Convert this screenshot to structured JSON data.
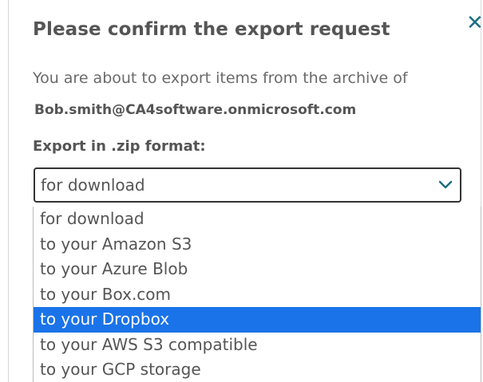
{
  "dialog": {
    "title": "Please confirm the export request",
    "close_glyph": "✕",
    "message": "You are about to export items from the archive of",
    "email": "Bob.smith@CA4software.onmicrosoft.com",
    "format_label": "Export in .zip format:"
  },
  "select": {
    "value": "for download",
    "icon": "chevron-down-icon",
    "options": [
      "for download",
      "to your Amazon S3",
      "to your Azure Blob",
      "to your Box.com",
      "to your Dropbox",
      "to your AWS S3 compatible",
      "to your GCP storage"
    ],
    "highlighted_option": "to your Dropbox"
  },
  "colors": {
    "title_text": "#555555",
    "body_text": "#6a6a6a",
    "close_icon": "#1e6f83",
    "chevron": "#1e6f83",
    "highlight": "#1a73e8"
  }
}
